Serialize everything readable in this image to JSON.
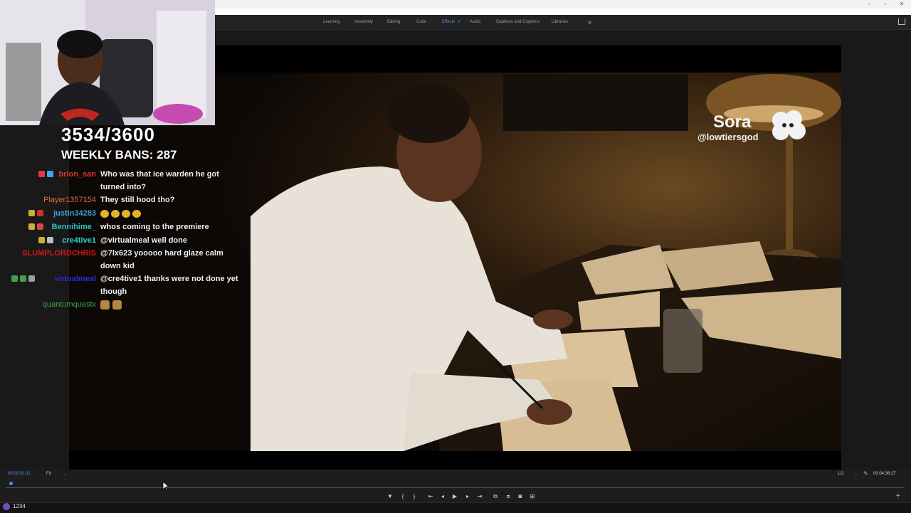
{
  "workspaces": {
    "tabs": [
      {
        "label": "Learning"
      },
      {
        "label": "Assembly"
      },
      {
        "label": "Editing"
      },
      {
        "label": "Color"
      },
      {
        "label": "Effects"
      },
      {
        "label": "Audio"
      },
      {
        "label": "Captions and Graphics"
      },
      {
        "label": "Libraries"
      }
    ],
    "active": "Effects",
    "more_icon": "double-chevron-right-icon",
    "share_icon": "share-icon"
  },
  "window_controls": [
    "minimize-icon",
    "restore-icon",
    "close-icon"
  ],
  "overlay": {
    "counter": "3534/3600",
    "weekly_bans": "WEEKLY BANS: 287"
  },
  "video": {
    "watermark_logo": "Sora",
    "watermark_handle": "@lowtiersgod",
    "watermark_icon": "sora-cloud-icon"
  },
  "chat": [
    {
      "user": "brion_san",
      "color": "#e0342a",
      "text": "Who was that ice warden he got turned into?",
      "badges": [
        "#e53935",
        "#42a5f5"
      ]
    },
    {
      "user": "Player1357154",
      "color": "#e06a3a",
      "text": "They still hood tho?",
      "badges": []
    },
    {
      "user": "justin34283",
      "color": "#3f9fd0",
      "text": "",
      "emotes": 4,
      "badges": [
        "#c9b037",
        "#d32f2f"
      ]
    },
    {
      "user": "Bennihime_",
      "color": "#2ec4c4",
      "text": "whos coming to the premiere",
      "badges": [
        "#c9b037",
        "#d44"
      ]
    },
    {
      "user": "cre4tive1",
      "color": "#2fd3d3",
      "text": "@virtualmeal well done",
      "badges": [
        "#c9b037",
        "#bdbdbd"
      ]
    },
    {
      "user": "SLUMPLORDCHRIS",
      "color": "#d01818",
      "text": "@7lx623 yooooo hard glaze calm down kid",
      "badges": []
    },
    {
      "user": "virtualmeal",
      "color": "#2a2ae0",
      "text": "@cre4tive1 thanks were not done yet though",
      "badges": [
        "#43a047",
        "#43a047",
        "#9e9e9e"
      ]
    },
    {
      "user": "quantumquestx",
      "color": "#3aa24a",
      "text": "",
      "faces": 2,
      "badges": []
    }
  ],
  "controls": {
    "timecode_current": "00:00:02:01",
    "fit_label": "Fit",
    "quality_label": "1/2",
    "timecode_total": "00:04:36:27",
    "progress_fraction": 0.004,
    "transport_icons": [
      "marker-icon",
      "mark-in-icon",
      "mark-out-icon",
      "go-to-in-icon",
      "step-back-icon",
      "play-icon",
      "step-forward-icon",
      "go-to-out-icon",
      "insert-icon",
      "overwrite-icon",
      "export-frame-icon",
      "compare-icon"
    ],
    "add_icon": "plus-icon"
  },
  "taskbar": {
    "viewer_count": "1234"
  }
}
